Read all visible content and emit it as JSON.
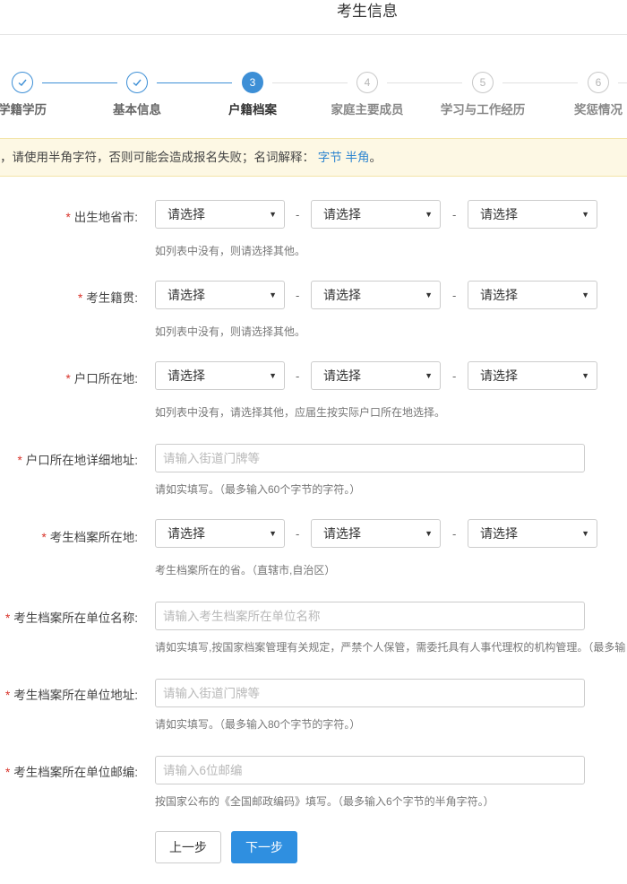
{
  "header": {
    "title": "考生信息"
  },
  "steps": [
    {
      "label": "学籍学历",
      "state": "done"
    },
    {
      "label": "基本信息",
      "state": "done"
    },
    {
      "number": "3",
      "label": "户籍档案",
      "state": "active"
    },
    {
      "number": "4",
      "label": "家庭主要成员",
      "state": "todo"
    },
    {
      "number": "5",
      "label": "学习与工作经历",
      "state": "todo"
    },
    {
      "number": "6",
      "label": "奖惩情况",
      "state": "todo"
    }
  ],
  "notice": {
    "text": "，请使用半角字符，否则可能会造成报名失败；名词解释：",
    "link1": "字节",
    "link2": "半角",
    "end": "。"
  },
  "form": {
    "required_mark": "*",
    "dash": "-",
    "birthplace": {
      "label": "出生地省市:",
      "selects": [
        "请选择",
        "请选择",
        "请选择"
      ],
      "hint": "如列表中没有，则请选择其他。"
    },
    "native_place": {
      "label": "考生籍贯:",
      "selects": [
        "请选择",
        "请选择",
        "请选择"
      ],
      "hint": "如列表中没有，则请选择其他。"
    },
    "household": {
      "label": "户口所在地:",
      "selects": [
        "请选择",
        "请选择",
        "请选择"
      ],
      "hint": "如列表中没有，请选择其他，应届生按实际户口所在地选择。"
    },
    "household_address": {
      "label": "户口所在地详细地址:",
      "placeholder": "请输入街道门牌等",
      "hint": "请如实填写。（最多输入60个字节的字符。）"
    },
    "archive_location": {
      "label": "考生档案所在地:",
      "selects": [
        "请选择",
        "请选择",
        "请选择"
      ],
      "hint": "考生档案所在的省。（直辖市,自治区）"
    },
    "archive_unit_name": {
      "label": "考生档案所在单位名称:",
      "placeholder": "请输入考生档案所在单位名称",
      "hint": "请如实填写,按国家档案管理有关规定，严禁个人保管，需委托具有人事代理权的机构管理。（最多输"
    },
    "archive_unit_address": {
      "label": "考生档案所在单位地址:",
      "placeholder": "请输入街道门牌等",
      "hint": "请如实填写。（最多输入80个字节的字符。）"
    },
    "archive_unit_postcode": {
      "label": "考生档案所在单位邮编:",
      "placeholder": "请输入6位邮编",
      "hint": "按国家公布的《全国邮政编码》填写。（最多输入6个字节的半角字符。）"
    }
  },
  "buttons": {
    "prev": "上一步",
    "next": "下一步"
  },
  "colors": {
    "accent": "#3d8fd6",
    "required": "#d9342b",
    "notice_bg": "#fdf8e4"
  }
}
